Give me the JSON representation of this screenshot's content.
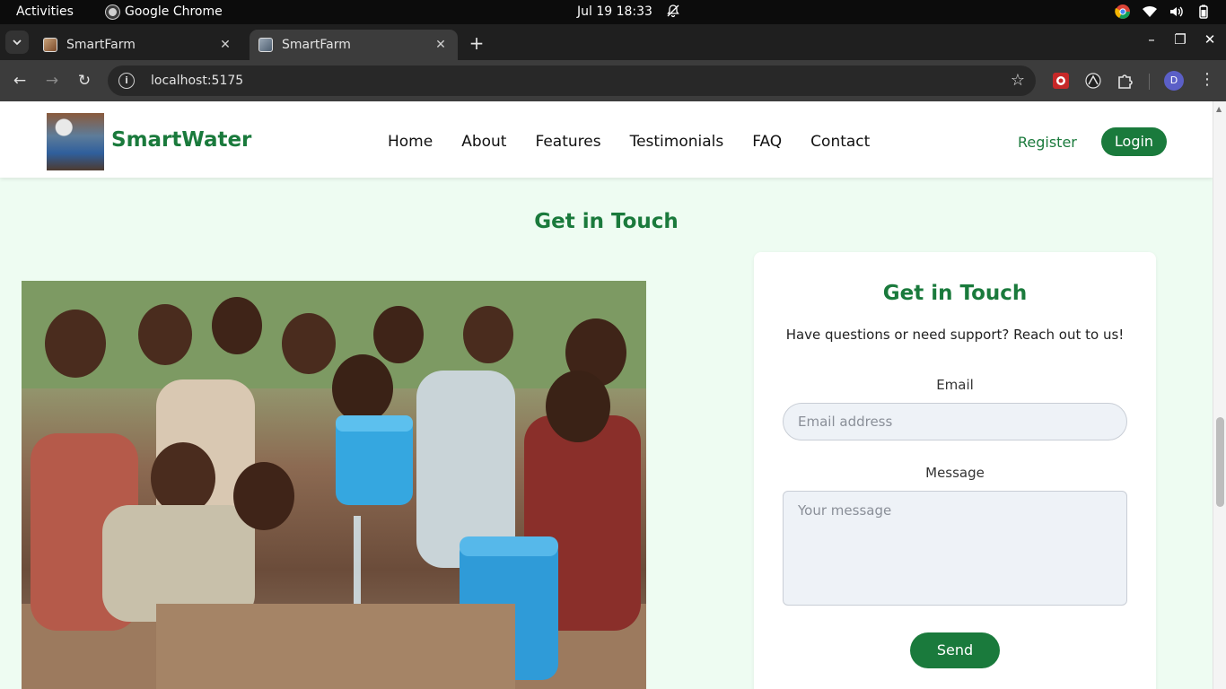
{
  "system_bar": {
    "activities": "Activities",
    "app_name": "Google Chrome",
    "clock": "Jul 19  18:33"
  },
  "browser": {
    "tabs": [
      {
        "title": "SmartFarm",
        "active": false
      },
      {
        "title": "SmartFarm",
        "active": true
      }
    ],
    "url": "localhost:5175",
    "profile_initial": "D"
  },
  "site": {
    "brand": "SmartWater",
    "nav": [
      "Home",
      "About",
      "Features",
      "Testimonials",
      "FAQ",
      "Contact"
    ],
    "register": "Register",
    "login": "Login",
    "accent_color": "#1a7a3c"
  },
  "section": {
    "title": "Get in Touch"
  },
  "contact_card": {
    "title": "Get in Touch",
    "subtitle": "Have questions or need support? Reach out to us!",
    "email_label": "Email",
    "email_placeholder": "Email address",
    "message_label": "Message",
    "message_placeholder": "Your message",
    "send": "Send"
  }
}
